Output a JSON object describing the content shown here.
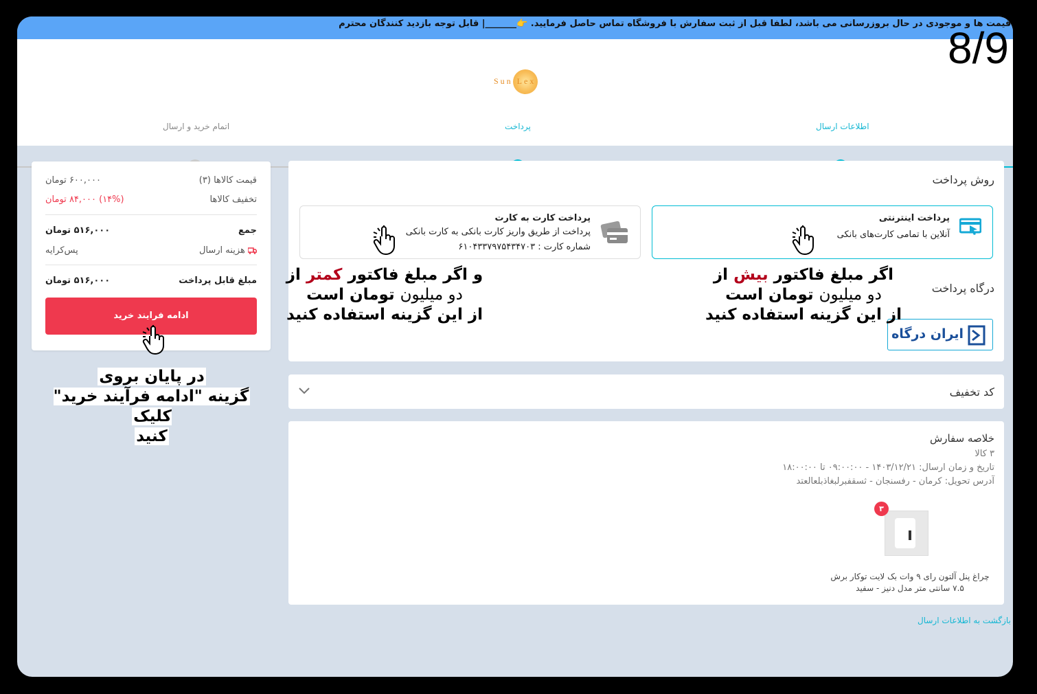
{
  "banner": {
    "text": "👈 قیمت ها و موجودی در حال بروزرسانی می باشد، لطفا قبل از ثبت سفارش با فروشگاه تماس حاصل فرمایید. 👉_______| قابل توجه بازدید کنندگان محترم"
  },
  "overlay_counter": "8/9",
  "logo": {
    "text": "Sun Lex"
  },
  "steps": [
    {
      "label": "اطلاعات ارسال",
      "state": "done"
    },
    {
      "label": "پرداخت",
      "state": "active"
    },
    {
      "label": "اتمام خرید و ارسال",
      "state": "pending"
    }
  ],
  "payment": {
    "title": "روش پرداخت",
    "online": {
      "title": "پرداخت اینترنتی",
      "subtitle": "آنلاین با تمامی کارت‌های بانکی"
    },
    "card": {
      "title": "پرداخت کارت به کارت",
      "subtitle": "پرداخت از طریق واریز کارت بانکی به کارت بانکی",
      "card_number": "شماره کارت : ۶۱۰۴۳۳۷۹۷۵۴۳۴۷۰۳"
    },
    "gateway_title": "درگاه پرداخت",
    "gateway_logo": "ایران درگاه"
  },
  "annotations": {
    "right": {
      "line1_a": "اگر مبلغ فاکتور ",
      "line1_red": "بیش",
      "line1_b": " از",
      "line2_thin": "دو میلیون",
      "line2_b": " تومان است",
      "line3": "از این گزینه استفاده کنید"
    },
    "left": {
      "line1_a": "و اگر مبلغ فاکتور ",
      "line1_red": "کمتر",
      "line1_b": " از",
      "line2_thin": "دو میلیون",
      "line2_b": " تومان است",
      "line3": "از این گزینه استفاده کنید"
    },
    "bottom": {
      "line1": "در پایان بروی",
      "line2": "گزینه \"ادامه فرآیند خرید\" کلیک",
      "line3": "کنید"
    }
  },
  "discount": {
    "title": "کد تخفیف"
  },
  "order_summary": {
    "title": "خلاصه سفارش",
    "items_count": "۳ کالا",
    "delivery_time": "تاریخ و زمان ارسال: ۱۴۰۳/۱۲/۲۱ - ۰۹:۰۰:۰۰ تا ۱۸:۰۰:۰۰",
    "address": "آدرس تحویل: کرمان - رفسنجان - ثسقفبرلبغاذبلعالعتد",
    "product_qty": "۳",
    "product_name_1": "چراغ پنل آلتون رای ۹ وات بک لایت توکار برش",
    "product_name_2": "۷.۵ سانتی متر مدل دنیز - سفید"
  },
  "summary": {
    "items_price_label": "قیمت کالاها (۳)",
    "items_price_value": "۶۰۰,۰۰۰ تومان",
    "discount_label": "تخفیف کالاها",
    "discount_value": "(۱۴%) ۸۴,۰۰۰ تومان",
    "total_label": "جمع",
    "total_value": "۵۱۶,۰۰۰ تومان",
    "shipping_label": "هزینه ارسال",
    "shipping_value": "پس‌کرایه",
    "payable_label": "مبلغ قابل پرداخت",
    "payable_value": "۵۱۶,۰۰۰ تومان",
    "continue_label": "ادامه فرایند خرید"
  },
  "back_link": "بازگشت به اطلاعات ارسال",
  "colors": {
    "accent": "#00bcd4",
    "danger": "#ef394e",
    "banner": "#5aa5f7",
    "page_bg": "#d6dfea"
  }
}
